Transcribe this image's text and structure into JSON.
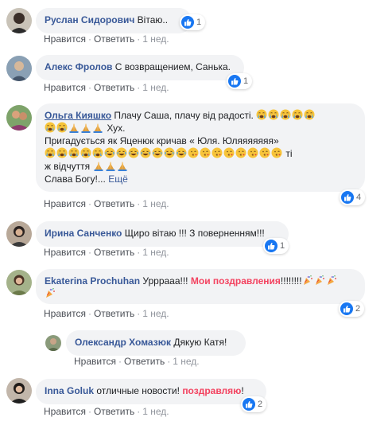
{
  "actions": {
    "like": "Нравится",
    "reply": "Ответить",
    "sep": "·"
  },
  "comments": [
    {
      "author": "Руслан Сидорович",
      "text": "Вітаю..",
      "time": "1 нед.",
      "likes": "1"
    },
    {
      "author": "Алекс Фролов",
      "text": "С возвращением, Санька.",
      "time": "1 нед.",
      "likes": "1"
    },
    {
      "author": "Ольга Кияшко",
      "line1": "Плачу Саша, плачу від радості.",
      "line2": "Хух.",
      "line3": "Пригадується як Яценюк кричав « Юля. Юляяяяяяя»",
      "line4": "ті",
      "line5": "ж відчуття",
      "line6": "Слава Богу!...",
      "more": "Ещё",
      "time": "1 нед.",
      "likes": "4"
    },
    {
      "author": "Ирина Санченко",
      "text": "Щиро вітаю !!! З поверненням!!!",
      "time": "1 нед.",
      "likes": "1"
    },
    {
      "author": "Ekaterina Prochuhan",
      "text": "Урррааа!!!",
      "highlight": "Мои поздравления",
      "tail": "!!!!!!!!",
      "time": "1 нед.",
      "likes": "2"
    },
    {
      "author": "Олександр Хомазюк",
      "text": "Дякую Катя!",
      "time": "1 нед."
    },
    {
      "author": "Inna Goluk",
      "text": "отличные новости!",
      "highlight": "поздравляю",
      "tail": "!",
      "time": "1 нед.",
      "likes": "2"
    }
  ],
  "colors": {
    "link": "#385898",
    "bubble": "#f2f3f5",
    "like": "#1877f2",
    "highlight": "#f3425f"
  },
  "icons": [
    "thumbs-up-icon",
    "crying-emoji-icon",
    "praying-hands-emoji-icon",
    "laughing-emoji-icon",
    "kiss-emoji-icon",
    "confetti-emoji-icon"
  ]
}
